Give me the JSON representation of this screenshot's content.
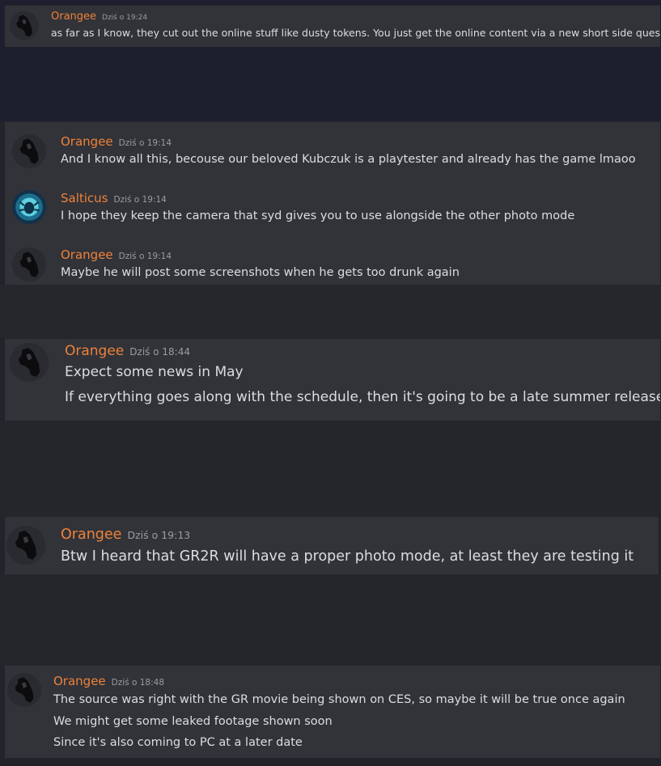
{
  "colors": {
    "username": "#f0813a",
    "timestamp": "#9a9ca3",
    "message_text": "#dcdde0",
    "card_bg": "#313338",
    "page_bg": "#23242b",
    "top_band": "#1e1f2e"
  },
  "icons": {
    "orangee_avatar": "black-horse-silhouette",
    "salticus_avatar": "teal-spider-emblem"
  },
  "cards": [
    {
      "messages": [
        {
          "author": "Orangee",
          "time": "Dziś o 19:24",
          "lines": [
            "as far as I know, they cut out the online stuff like dusty tokens. You just get the online content via a new short side quest"
          ]
        }
      ]
    },
    {
      "messages": [
        {
          "author": "Orangee",
          "time": "Dziś o 19:14",
          "lines": [
            "And I know all this, becouse our beloved Kubczuk is a playtester and already has the game lmaoo"
          ]
        },
        {
          "author": "Salticus",
          "time": "Dziś o 19:14",
          "lines": [
            "I hope they keep the camera that syd gives you to use alongside the other photo mode"
          ]
        },
        {
          "author": "Orangee",
          "time": "Dziś o 19:14",
          "lines": [
            "Maybe he will post some screenshots when he gets too drunk again"
          ]
        }
      ]
    },
    {
      "messages": [
        {
          "author": "Orangee",
          "time": "Dziś o 18:44",
          "lines": [
            "Expect some news in May",
            "If everything goes along with the schedule, then it's going to be a late summer release"
          ]
        }
      ]
    },
    {
      "messages": [
        {
          "author": "Orangee",
          "time": "Dziś o 19:13",
          "lines": [
            "Btw I heard that GR2R will have a proper photo mode, at least they are testing it"
          ]
        }
      ]
    },
    {
      "messages": [
        {
          "author": "Orangee",
          "time": "Dziś o 18:48",
          "lines": [
            "The source was right with the GR movie being shown on CES, so maybe it will be true once again",
            "We might get some leaked footage shown soon",
            "Since it's also coming to PC at a later date"
          ]
        }
      ]
    }
  ]
}
